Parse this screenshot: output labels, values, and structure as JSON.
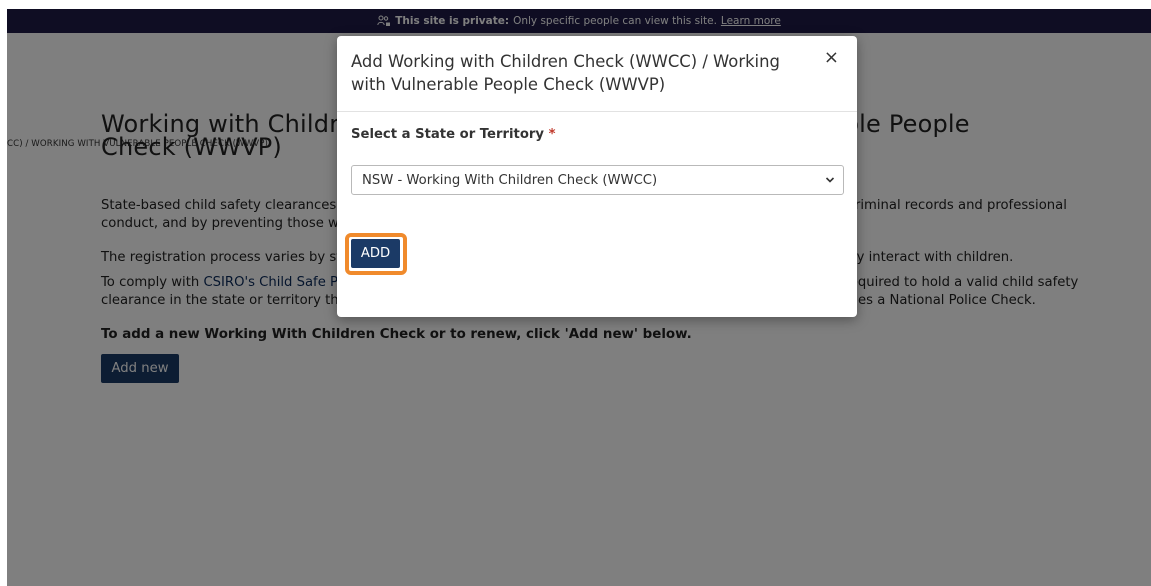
{
  "banner": {
    "bold_text": "This site is private:",
    "text": "Only specific people can view this site.",
    "link": "Learn more"
  },
  "breadcrumb": "CC) / WORKING WITH VULNERABLE PEOPLE CHECK (WWVP)",
  "page_title": "Working with Children Check (WWCC) / Working with Vulnerable People Check (WWVP)",
  "paragraphs": {
    "p1": "State-based child safety clearances (Working with Children Check) aim to protect children by screening people's criminal records and professional conduct, and by preventing those who pose an unjustifiable risk to children from working with or caring for them.",
    "p2": "The registration process varies by state and territory and is required by law for each state or territory that you may interact with children.",
    "p3_prefix": "To comply with ",
    "p3_link": "CSIRO's Child Safe Policy",
    "p3_suffix": ", all STEM professionals participating in a CSIRO Education program are required to hold a valid child safety clearance in the state or territory they reside in. Please note, each state and territory child safety clearance includes a National Police Check.",
    "p4": "To add a new Working With Children Check or to renew, click 'Add new' below."
  },
  "add_new_label": "Add new",
  "modal": {
    "title": "Add Working with Children Check (WWCC) / Working with Vulnerable People Check (WWVP)",
    "close": "×",
    "field_label": "Select a State or Territory",
    "required_mark": "*",
    "selected_option": "NSW  - Working With Children Check (WWCC)",
    "add_label": "ADD"
  },
  "colors": {
    "banner": "#1e1b46",
    "primary_button": "#1b3a66",
    "highlight": "#f08a2c",
    "required": "#c0392b"
  }
}
